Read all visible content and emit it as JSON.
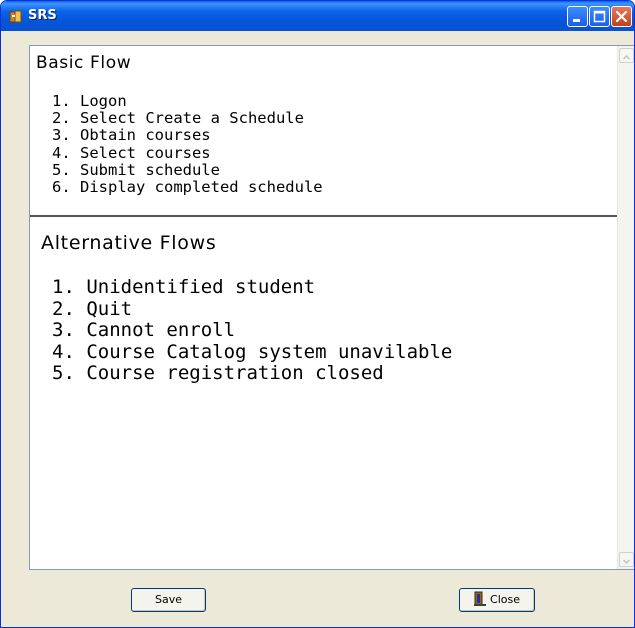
{
  "window": {
    "title": "SRS",
    "icon": "srs-app-icon"
  },
  "titlebar_buttons": {
    "minimize_icon": "minimize-icon",
    "maximize_icon": "maximize-icon",
    "close_icon": "close-x-icon"
  },
  "content": {
    "basic_flow": {
      "title": "Basic Flow",
      "items": [
        "1. Logon",
        "2. Select Create a Schedule",
        "3. Obtain courses",
        "4. Select courses",
        "5. Submit schedule",
        "6. Display completed schedule"
      ]
    },
    "alternative_flows": {
      "title": "Alternative Flows",
      "items": [
        "1. Unidentified student",
        "2. Quit",
        "3. Cannot enroll",
        "4. Course Catalog system unavilable",
        "5. Course registration closed"
      ]
    }
  },
  "buttons": {
    "save_label": "Save",
    "close_label": "Close",
    "close_icon": "door-exit-icon"
  },
  "colors": {
    "titlebar": "#0a5ee6",
    "window_bg": "#ece9d8",
    "close_button": "#c2411a"
  }
}
